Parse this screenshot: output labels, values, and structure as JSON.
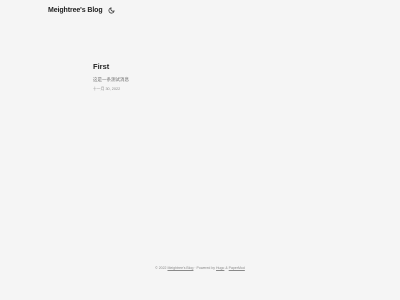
{
  "header": {
    "site_title": "Meightree's Blog",
    "theme_toggle_icon": "moon-icon"
  },
  "post": {
    "title": "First",
    "excerpt": "这是一条测试消息",
    "meta": "十一月 30, 2022"
  },
  "footer": {
    "copyright": "© 2022 ",
    "site_link": "Meightree's Blog",
    "powered_by": " · Powered by ",
    "hugo_link": "Hugo",
    "amp": " & ",
    "papermod_link": "PaperMod"
  },
  "colors": {
    "background": "#f5f5f5",
    "text": "#1f1f1f",
    "muted": "#8a8a8a"
  }
}
